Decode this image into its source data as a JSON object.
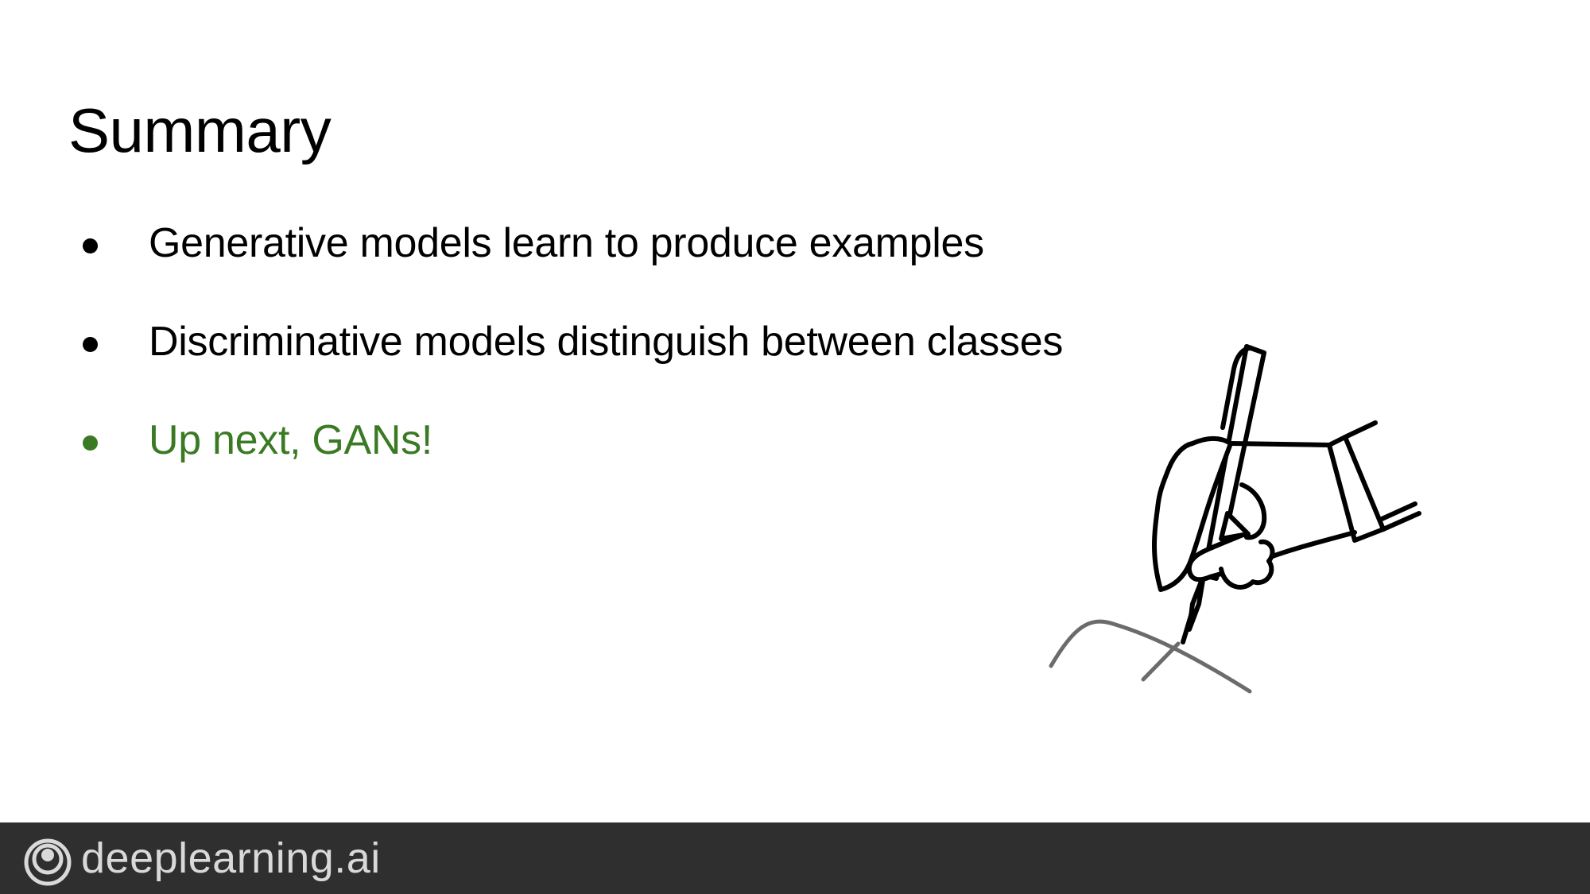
{
  "slide": {
    "title": "Summary",
    "bullets": [
      {
        "text": "Generative models learn to produce examples",
        "color": "#000000"
      },
      {
        "text": "Discriminative models distinguish between classes",
        "color": "#000000"
      },
      {
        "text": "Up next, GANs!",
        "color": "#3b7a24"
      }
    ],
    "illustration_icon": "hand-writing-with-pen-icon"
  },
  "footer": {
    "brand_text": "deeplearning.ai",
    "logo_icon": "deeplearning-logo-icon",
    "background_color": "#2f2f2f",
    "text_color": "#d9d9d9"
  },
  "colors": {
    "text": "#000000",
    "accent": "#3b7a24",
    "curve": "#6b6b6b"
  }
}
